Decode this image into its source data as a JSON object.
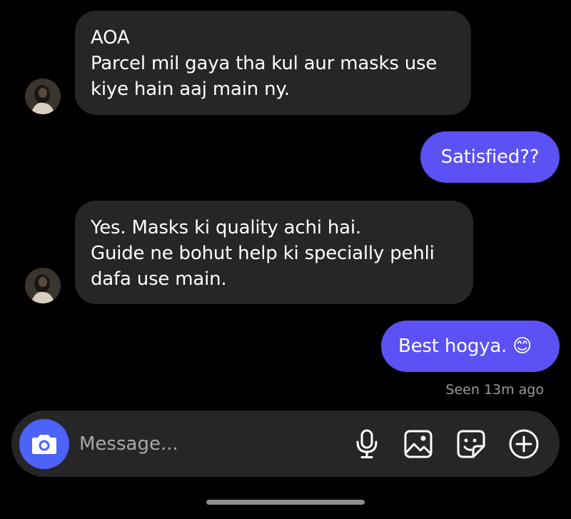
{
  "messages": [
    {
      "side": "incoming",
      "lines": [
        "AOA",
        "Parcel mil gaya tha kul aur masks use",
        "kiye hain aaj main ny."
      ]
    },
    {
      "side": "outgoing",
      "text": "Satisfied??"
    },
    {
      "side": "incoming",
      "lines": [
        "Yes. Masks ki quality achi hai.",
        "Guide ne bohut help ki specially pehli",
        "dafa use main."
      ]
    },
    {
      "side": "outgoing",
      "text": "Best hogya. 😊"
    }
  ],
  "seen_status": "Seen 13m ago",
  "composer": {
    "placeholder": "Message...",
    "camera_icon": "camera-icon",
    "tools": [
      "microphone-icon",
      "image-icon",
      "sticker-icon",
      "plus-circle-icon"
    ]
  },
  "colors": {
    "background": "#000000",
    "incoming_bubble": "#262626",
    "outgoing_bubble": "#5b51f5",
    "camera_button": "#4c62f8",
    "muted_text": "#9a9a9a"
  }
}
